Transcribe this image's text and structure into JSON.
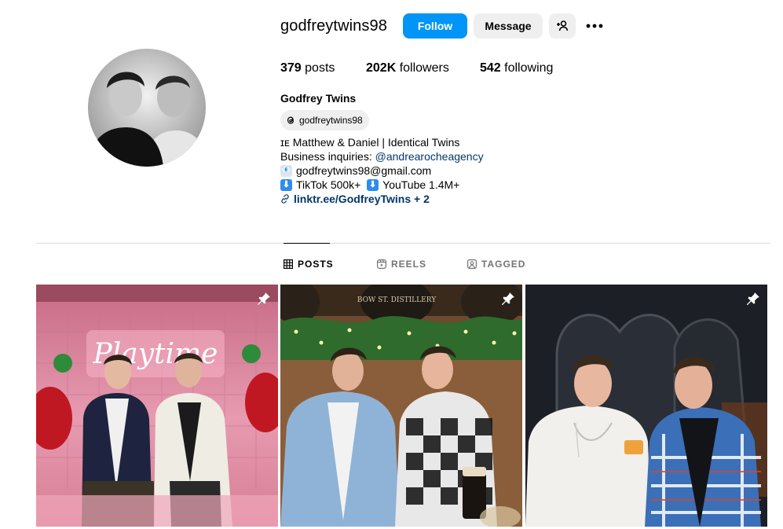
{
  "profile": {
    "username": "godfreytwins98",
    "full_name": "Godfrey Twins",
    "avatar_icon": "profile-photo-icon"
  },
  "actions": {
    "follow_label": "Follow",
    "message_label": "Message",
    "add_user_icon": "add-user-icon",
    "more_icon": "more-options-icon"
  },
  "stats": {
    "posts_count": "379",
    "posts_label": "posts",
    "followers_count": "202K",
    "followers_label": "followers",
    "following_count": "542",
    "following_label": "following"
  },
  "threads": {
    "handle": "godfreytwins98",
    "icon": "threads-icon"
  },
  "bio": {
    "line1": "ɪᴇ Matthew & Daniel | Identical Twins",
    "line2_prefix": "Business inquiries: ",
    "line2_mention": "@andrearocheagency",
    "email_icon": "📧",
    "email": "godfreytwins98@gmail.com",
    "line4_part1": "TikTok 500k+",
    "line4_part2": "YouTube 1.4M+",
    "down_arrow_emoji": "⬇",
    "link": "linktr.ee/GodfreyTwins + 2"
  },
  "tabs": [
    {
      "label": "POSTS",
      "icon": "grid-icon",
      "active": true
    },
    {
      "label": "REELS",
      "icon": "reels-icon",
      "active": false
    },
    {
      "label": "TAGGED",
      "icon": "tagged-icon",
      "active": false
    }
  ],
  "posts": [
    {
      "pinned": true,
      "pin_icon": "pin-icon",
      "sign_text": "Playtime"
    },
    {
      "pinned": true,
      "pin_icon": "pin-icon",
      "sign_text": "BOW ST. DISTILLERY"
    },
    {
      "pinned": true,
      "pin_icon": "pin-icon"
    }
  ],
  "colors": {
    "primary_button": "#0095f6",
    "secondary_button": "#efefef",
    "link": "#00376b",
    "muted_text": "#737373",
    "divider": "#dbdbdb"
  }
}
